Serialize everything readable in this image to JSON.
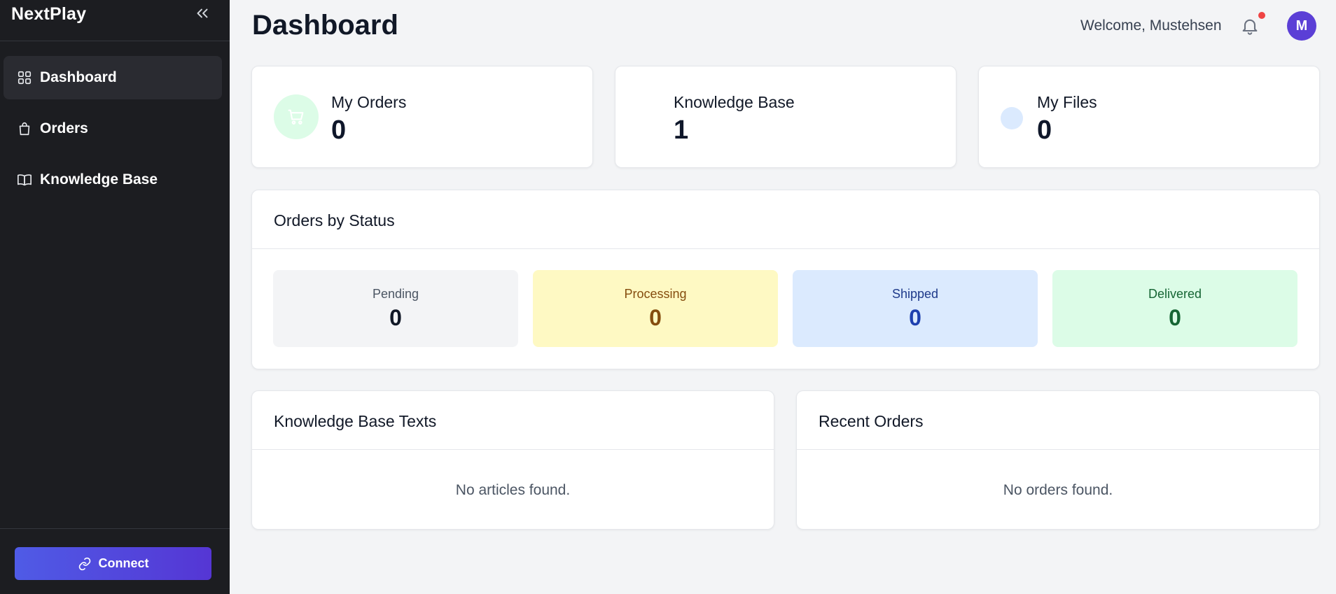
{
  "sidebar": {
    "brand": "NextPlay",
    "items": [
      {
        "label": "Dashboard",
        "icon": "grid-icon",
        "active": true
      },
      {
        "label": "Orders",
        "icon": "shopping-bag-icon",
        "active": false
      },
      {
        "label": "Knowledge Base",
        "icon": "book-icon",
        "active": false
      }
    ],
    "connect_label": "Connect"
  },
  "header": {
    "title": "Dashboard",
    "welcome": "Welcome, Mustehsen",
    "avatar_initial": "M"
  },
  "stats": [
    {
      "label": "My Orders",
      "value": "0",
      "icon": "cart-icon",
      "icon_bg": "#dcfce7"
    },
    {
      "label": "Knowledge Base",
      "value": "1",
      "icon": "book-icon",
      "icon_bg": "#ffffff"
    },
    {
      "label": "My Files",
      "value": "0",
      "icon": "file-icon",
      "icon_bg": "#dbeafe"
    }
  ],
  "orders_by_status": {
    "title": "Orders by Status",
    "statuses": [
      {
        "label": "Pending",
        "value": "0",
        "bg": "#f3f4f6",
        "label_color": "#4b5563",
        "value_color": "#111827"
      },
      {
        "label": "Processing",
        "value": "0",
        "bg": "#fef9c3",
        "label_color": "#854d0e",
        "value_color": "#854d0e"
      },
      {
        "label": "Shipped",
        "value": "0",
        "bg": "#dbeafe",
        "label_color": "#1e3a8a",
        "value_color": "#1e40af"
      },
      {
        "label": "Delivered",
        "value": "0",
        "bg": "#dcfce7",
        "label_color": "#166534",
        "value_color": "#166534"
      }
    ]
  },
  "knowledge_base_texts": {
    "title": "Knowledge Base Texts",
    "empty": "No articles found."
  },
  "recent_orders": {
    "title": "Recent Orders",
    "empty": "No orders found."
  },
  "colors": {
    "sidebar_bg": "#1c1d21",
    "accent": "#5b3fd6",
    "notification": "#ef4444"
  }
}
